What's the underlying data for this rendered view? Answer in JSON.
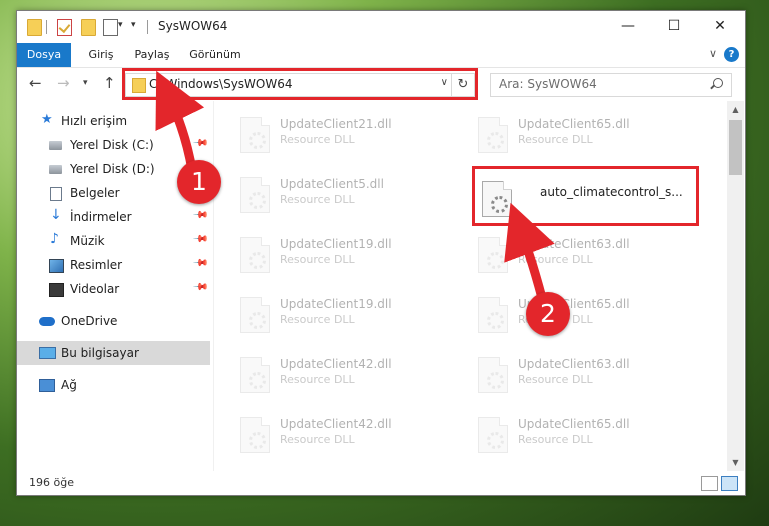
{
  "window": {
    "title": "SysWOW64",
    "controls": {
      "minimize": "—",
      "maximize": "☐",
      "close": "✕"
    }
  },
  "ribbon": {
    "tabs": [
      {
        "label": "Dosya",
        "active": true
      },
      {
        "label": "Giriş"
      },
      {
        "label": "Paylaş"
      },
      {
        "label": "Görünüm"
      }
    ],
    "help": "?"
  },
  "address": {
    "path": "C:\\Windows\\SysWOW64"
  },
  "search": {
    "placeholder": "Ara: SysWOW64"
  },
  "sidebar": {
    "items": [
      {
        "label": "Hızlı erişim",
        "icon": "star-icon"
      },
      {
        "label": "Yerel Disk (C:)",
        "icon": "drive-icon",
        "pinned": true
      },
      {
        "label": "Yerel Disk (D:)",
        "icon": "drive-icon"
      },
      {
        "label": "Belgeler",
        "icon": "documents-icon"
      },
      {
        "label": "İndirmeler",
        "icon": "download-icon",
        "pinned": true
      },
      {
        "label": "Müzik",
        "icon": "music-icon",
        "pinned": true
      },
      {
        "label": "Resimler",
        "icon": "pictures-icon",
        "pinned": true
      },
      {
        "label": "Videolar",
        "icon": "videos-icon",
        "pinned": true
      },
      {
        "label": "OneDrive",
        "icon": "cloud-icon"
      },
      {
        "label": "Bu bilgisayar",
        "icon": "computer-icon",
        "selected": true
      },
      {
        "label": "Ağ",
        "icon": "network-icon"
      }
    ]
  },
  "files": [
    {
      "name": "UpdateClient21.dll",
      "type": "Resource DLL"
    },
    {
      "name": "UpdateClient65.dll",
      "type": "Resource DLL"
    },
    {
      "name": "UpdateClient5.dll",
      "type": "Resource DLL"
    },
    {
      "name": "auto_climatecontrol_s...",
      "type": "",
      "highlight": true
    },
    {
      "name": "UpdateClient19.dll",
      "type": "Resource DLL"
    },
    {
      "name": "UpdateClient63.dll",
      "type": "Resource DLL"
    },
    {
      "name": "UpdateClient19.dll",
      "type": "Resource DLL"
    },
    {
      "name": "UpdateClient65.dll",
      "type": "Resource DLL"
    },
    {
      "name": "UpdateClient42.dll",
      "type": "Resource DLL"
    },
    {
      "name": "UpdateClient63.dll",
      "type": "Resource DLL"
    },
    {
      "name": "UpdateClient42.dll",
      "type": "Resource DLL"
    },
    {
      "name": "UpdateClient65.dll",
      "type": "Resource DLL"
    }
  ],
  "status": {
    "item_count": "196 öğe"
  },
  "annotations": {
    "step1": "1",
    "step2": "2",
    "color": "#e3262b"
  }
}
